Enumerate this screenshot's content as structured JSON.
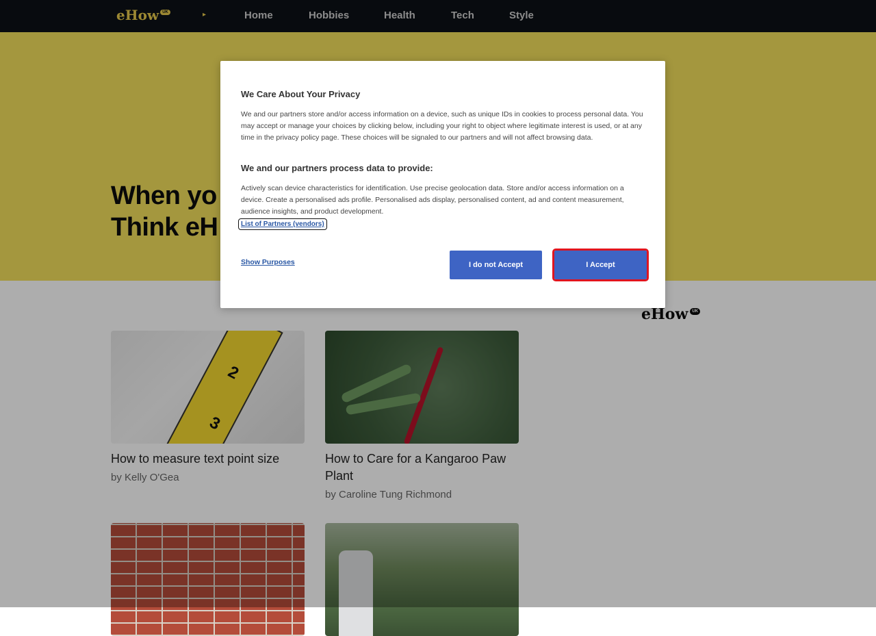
{
  "nav": {
    "logo": "eHow",
    "logo_badge": "UK",
    "arrow": "▸",
    "links": [
      "Home",
      "Hobbies",
      "Health",
      "Tech",
      "Style"
    ]
  },
  "hero": {
    "line1": "When yo",
    "line2": "Think eH"
  },
  "side_logo": {
    "text": "eHow",
    "badge": "UK"
  },
  "articles": [
    {
      "title": "How to measure text point size",
      "byline": "by Kelly O'Gea"
    },
    {
      "title": "How to Care for a Kangaroo Paw Plant",
      "byline": "by Caroline Tung Richmond"
    },
    {
      "title": "",
      "byline": ""
    },
    {
      "title": "",
      "byline": ""
    }
  ],
  "consent": {
    "heading": "We Care About Your Privacy",
    "body": "We and our partners store and/or access information on a device, such as unique IDs in cookies to process personal data. You may accept or manage your choices by clicking below, including your right to object where legitimate interest is used, or at any time in the privacy policy page. These choices will be signaled to our partners and will not affect browsing data.",
    "subheading": "We and our partners process data to provide:",
    "purposes": "Actively scan device characteristics for identification. Use precise geolocation data. Store and/or access information on a device. Create a personalised ads profile. Personalised ads display, personalised content, ad and content measurement, audience insights, and product development.",
    "vendors_link": "List of Partners (vendors)",
    "show_purposes": "Show Purposes",
    "reject_label": "I do not Accept",
    "accept_label": "I Accept"
  },
  "colors": {
    "nav_bg": "#0d1117",
    "hero_bg": "#f2df5c",
    "button_blue": "#3e64c4",
    "highlight_red": "#e0151f",
    "link_blue": "#2957a4"
  }
}
